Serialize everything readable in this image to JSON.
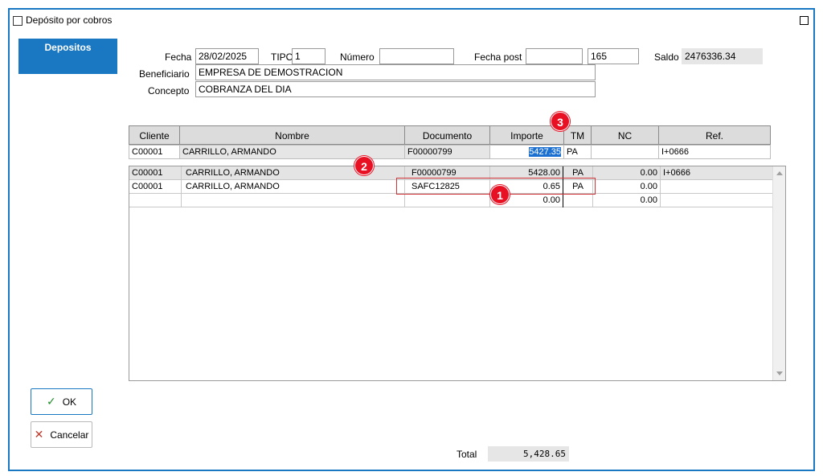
{
  "window": {
    "title": "Depósito por cobros"
  },
  "sidebar": {
    "depositos_label": "Depositos"
  },
  "form": {
    "fecha_label": "Fecha",
    "fecha_value": "28/02/2025",
    "tipo_label": "TIPO",
    "tipo_value": "1",
    "numero_label": "Número",
    "numero_value": "",
    "fecha_post_label": "Fecha post",
    "fecha_post_value": "",
    "extra_value": "165",
    "saldo_label": "Saldo",
    "saldo_value": "2476336.34",
    "beneficiario_label": "Beneficiario",
    "beneficiario_value": "EMPRESA DE DEMOSTRACION",
    "concepto_label": "Concepto",
    "concepto_value": "COBRANZA DEL DIA"
  },
  "header_grid": {
    "columns": [
      "Cliente",
      "Nombre",
      "Documento",
      "Importe",
      "TM",
      "NC",
      "Ref."
    ],
    "row": {
      "cliente": "C00001",
      "nombre": "CARRILLO, ARMANDO",
      "documento": "F00000799",
      "importe": "5427.35",
      "tm": "PA",
      "nc": "",
      "ref": "I+0666"
    }
  },
  "detail_grid": {
    "rows": [
      {
        "cliente": "C00001",
        "nombre": "CARRILLO, ARMANDO",
        "documento": "F00000799",
        "importe": "5428.00",
        "tm": "PA",
        "nc": "0.00",
        "ref": "I+0666"
      },
      {
        "cliente": "C00001",
        "nombre": "CARRILLO, ARMANDO",
        "documento": "SAFC12825",
        "importe": "0.65",
        "tm": "PA",
        "nc": "0.00",
        "ref": ""
      },
      {
        "cliente": "",
        "nombre": "",
        "documento": "",
        "importe": "0.00",
        "tm": "",
        "nc": "0.00",
        "ref": ""
      }
    ]
  },
  "annotations": {
    "badge1": "1",
    "badge2": "2",
    "badge3": "3"
  },
  "buttons": {
    "ok_label": "OK",
    "cancel_label": "Cancelar"
  },
  "total": {
    "label": "Total",
    "value": "5,428.65"
  },
  "colors": {
    "accent": "#1a78c2",
    "badge": "#e81123",
    "highlight": "#d13438"
  }
}
